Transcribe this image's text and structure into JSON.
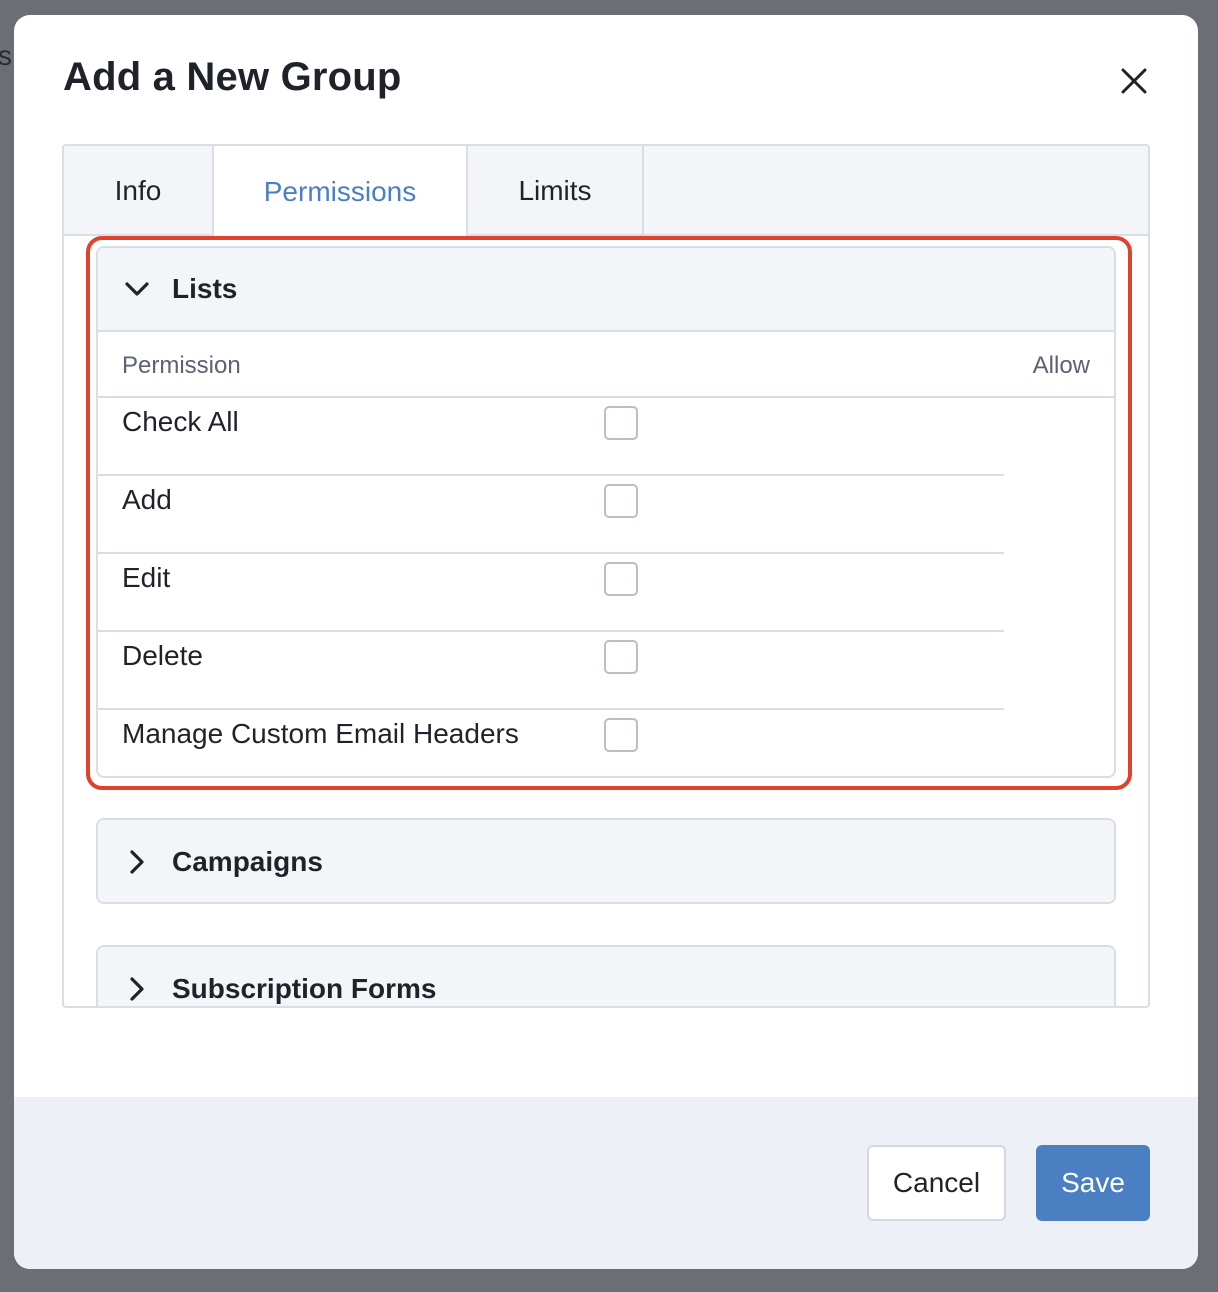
{
  "backdrop": {
    "partial_text": "s"
  },
  "modal": {
    "title": "Add a New Group",
    "close_icon": "close-icon"
  },
  "tabs": [
    {
      "label": "Info",
      "active": false
    },
    {
      "label": "Permissions",
      "active": true
    },
    {
      "label": "Limits",
      "active": false
    }
  ],
  "colors": {
    "accent": "#4a7fc1",
    "highlight": "#e0422e",
    "panel_bg": "#f4f5f9",
    "footer_bg": "#edf0f6"
  },
  "sections": {
    "lists": {
      "title": "Lists",
      "expanded": true,
      "icon": "chevron-down-icon",
      "columns": {
        "permission": "Permission",
        "allow": "Allow"
      },
      "permissions": [
        {
          "label": "Check All",
          "checked": false
        },
        {
          "label": "Add",
          "checked": false
        },
        {
          "label": "Edit",
          "checked": false
        },
        {
          "label": "Delete",
          "checked": false
        },
        {
          "label": "Manage Custom Email Headers",
          "checked": false
        }
      ]
    },
    "campaigns": {
      "title": "Campaigns",
      "expanded": false,
      "icon": "chevron-right-icon"
    },
    "subscription_forms": {
      "title": "Subscription Forms",
      "expanded": false,
      "icon": "chevron-right-icon"
    }
  },
  "footer": {
    "cancel_label": "Cancel",
    "save_label": "Save"
  }
}
